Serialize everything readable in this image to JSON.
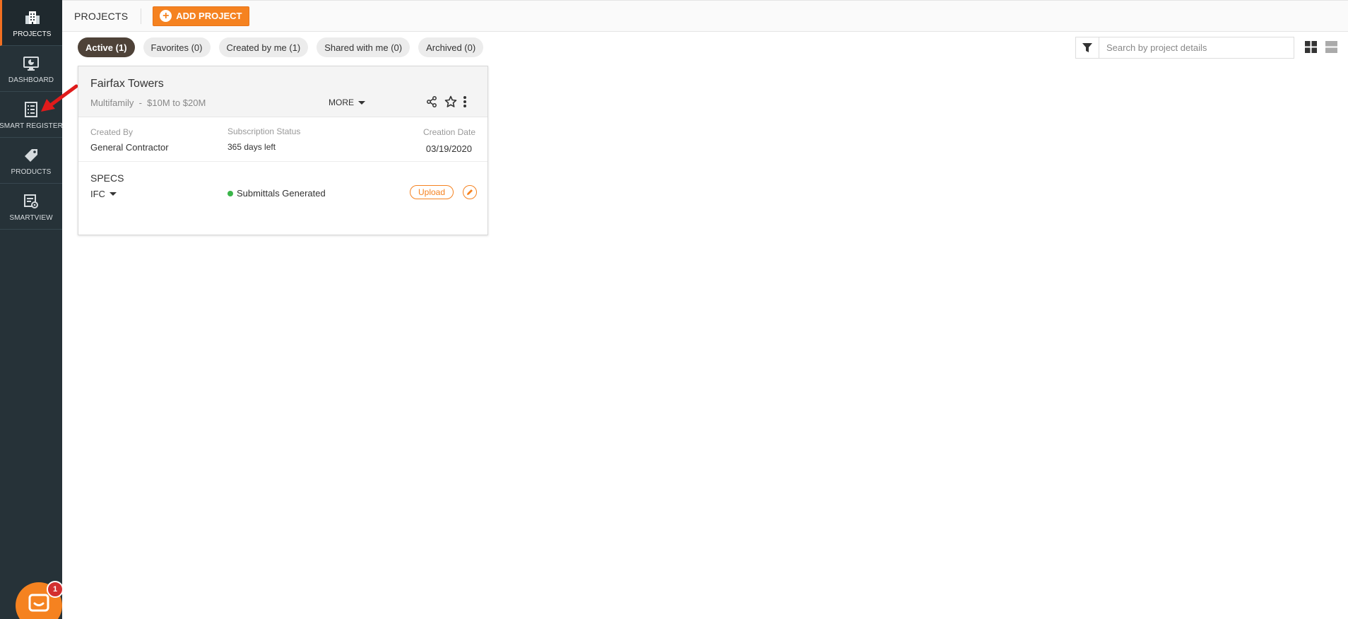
{
  "sidebar": {
    "items": [
      {
        "label": "PROJECTS",
        "icon": "building-icon",
        "active": true
      },
      {
        "label": "DASHBOARD",
        "icon": "monitor-icon",
        "active": false
      },
      {
        "label": "SMART REGISTER",
        "icon": "list-icon",
        "active": false
      },
      {
        "label": "PRODUCTS",
        "icon": "tag-icon",
        "active": false
      },
      {
        "label": "SMARTVIEW",
        "icon": "smartview-icon",
        "active": false
      }
    ]
  },
  "header": {
    "title": "PROJECTS",
    "add_project_label": "ADD PROJECT"
  },
  "filters": [
    {
      "label": "Active (1)",
      "active": true
    },
    {
      "label": "Favorites (0)",
      "active": false
    },
    {
      "label": "Created by me (1)",
      "active": false
    },
    {
      "label": "Shared with me (0)",
      "active": false
    },
    {
      "label": "Archived (0)",
      "active": false
    }
  ],
  "search": {
    "placeholder": "Search by project details",
    "value": ""
  },
  "project_card": {
    "title": "Fairfax Towers",
    "meta": "Multifamily  -  $10M to $20M",
    "more_label": "MORE",
    "created_by_label": "Created By",
    "created_by_value": "General Contractor",
    "subscription_label": "Subscription Status",
    "subscription_value": "365 days left",
    "creation_date_label": "Creation Date",
    "creation_date_value": "03/19/2020",
    "specs_title": "SPECS",
    "specs_version": "IFC",
    "specs_status": "Submittals Generated",
    "upload_label": "Upload"
  },
  "chat": {
    "badge_count": "1"
  },
  "colors": {
    "sidebar_bg": "#263238",
    "accent": "#f58220",
    "active_chip": "#4e4238",
    "status_green": "#3bb54a",
    "annotation_arrow": "#e01b1b"
  }
}
